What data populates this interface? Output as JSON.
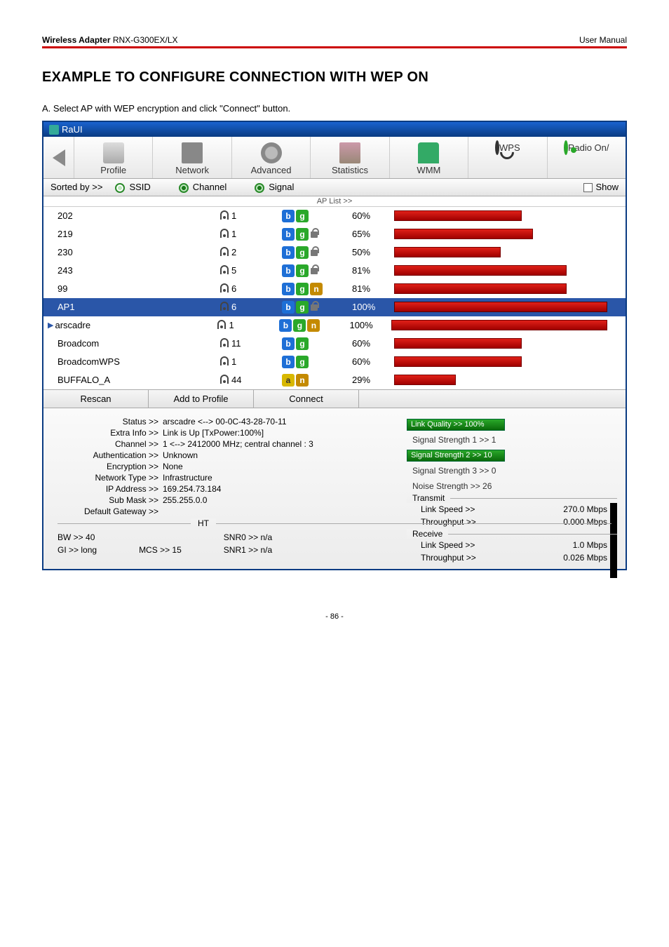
{
  "header": {
    "product_label": "Wireless Adapter",
    "product_model": "RNX-G300EX/LX",
    "right": "User Manual"
  },
  "title": "EXAMPLE TO CONFIGURE CONNECTION WITH WEP ON",
  "step": "A. Select AP with WEP encryption and click \"Connect\" button.",
  "window": {
    "title": "RaUI"
  },
  "toolbar": {
    "profile": "Profile",
    "network": "Network",
    "advanced": "Advanced",
    "statistics": "Statistics",
    "wmm": "WMM",
    "wps": "WPS",
    "radio": "Radio On/"
  },
  "sortbar": {
    "label": "Sorted by >>",
    "ssid": "SSID",
    "channel": "Channel",
    "signal": "Signal",
    "show": "Show"
  },
  "aplist_label": "AP List >>",
  "aplist": [
    {
      "ssid": "202",
      "chan": "1",
      "modes": [
        "b",
        "g"
      ],
      "lock": false,
      "signal": "60%",
      "bar": 60
    },
    {
      "ssid": "219",
      "chan": "1",
      "modes": [
        "b",
        "g"
      ],
      "lock": true,
      "signal": "65%",
      "bar": 65
    },
    {
      "ssid": "230",
      "chan": "2",
      "modes": [
        "b",
        "g"
      ],
      "lock": true,
      "signal": "50%",
      "bar": 50
    },
    {
      "ssid": "243",
      "chan": "5",
      "modes": [
        "b",
        "g"
      ],
      "lock": true,
      "signal": "81%",
      "bar": 81
    },
    {
      "ssid": "99",
      "chan": "6",
      "modes": [
        "b",
        "g",
        "n"
      ],
      "lock": false,
      "signal": "81%",
      "bar": 81
    },
    {
      "ssid": "AP1",
      "chan": "6",
      "modes": [
        "b",
        "g"
      ],
      "lock": true,
      "signal": "100%",
      "bar": 100,
      "selected": true
    },
    {
      "ssid": "arscadre",
      "chan": "1",
      "modes": [
        "b",
        "g",
        "n"
      ],
      "lock": false,
      "signal": "100%",
      "bar": 100,
      "current": true
    },
    {
      "ssid": "Broadcom",
      "chan": "11",
      "modes": [
        "b",
        "g"
      ],
      "lock": false,
      "signal": "60%",
      "bar": 60
    },
    {
      "ssid": "BroadcomWPS",
      "chan": "1",
      "modes": [
        "b",
        "g"
      ],
      "lock": false,
      "signal": "60%",
      "bar": 60
    },
    {
      "ssid": "BUFFALO_A",
      "chan": "44",
      "modes": [
        "a",
        "n"
      ],
      "lock": false,
      "signal": "29%",
      "bar": 29
    }
  ],
  "buttons": {
    "rescan": "Rescan",
    "add": "Add to Profile",
    "connect": "Connect"
  },
  "details": {
    "status_k": "Status >>",
    "status_v": "arscadre <--> 00-0C-43-28-70-11",
    "extra_k": "Extra Info >>",
    "extra_v": "Link is Up [TxPower:100%]",
    "chan_k": "Channel >>",
    "chan_v": "1 <--> 2412000 MHz; central channel : 3",
    "auth_k": "Authentication >>",
    "auth_v": "Unknown",
    "enc_k": "Encryption >>",
    "enc_v": "None",
    "net_k": "Network Type >>",
    "net_v": "Infrastructure",
    "ip_k": "IP Address >>",
    "ip_v": "169.254.73.184",
    "mask_k": "Sub Mask >>",
    "mask_v": "255.255.0.0",
    "gw_k": "Default Gateway >>",
    "gw_v": ""
  },
  "stats": {
    "lq": "Link Quality >> 100%",
    "s1": "Signal Strength 1 >> 1",
    "s2": "Signal Strength 2 >> 10",
    "s3": "Signal Strength 3 >> 0",
    "ns": "Noise Strength >> 26"
  },
  "transmit": {
    "legend": "Transmit",
    "ls_k": "Link Speed >>",
    "ls_v": "270.0 Mbps",
    "tp_k": "Throughput >>",
    "tp_v": "0.000 Mbps"
  },
  "receive": {
    "legend": "Receive",
    "ls_k": "Link Speed >>",
    "ls_v": "1.0 Mbps",
    "tp_k": "Throughput >>",
    "tp_v": "0.026 Mbps"
  },
  "ht": {
    "legend": "HT",
    "bw_k": "BW >>",
    "bw_v": "40",
    "gi_k": "GI >>",
    "gi_v": "long",
    "mcs_k": "MCS >>",
    "mcs_v": "15",
    "s0_k": "SNR0 >>",
    "s0_v": "n/a",
    "s1_k": "SNR1 >>",
    "s1_v": "n/a"
  },
  "page_num": "- 86 -"
}
